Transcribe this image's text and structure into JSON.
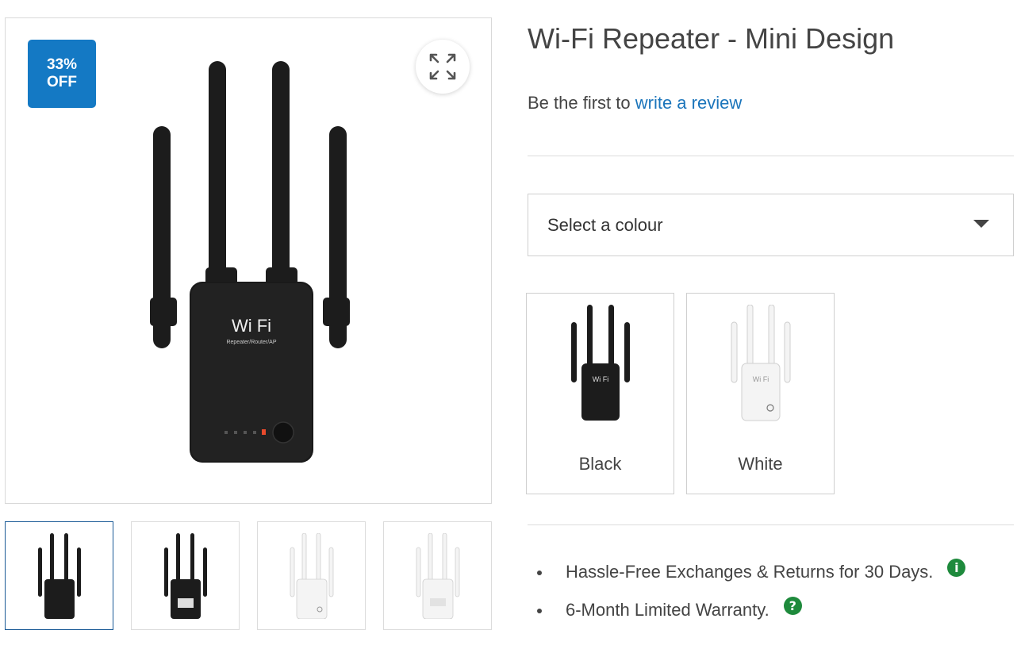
{
  "product": {
    "title": "Wi-Fi Repeater - Mini Design",
    "review_prefix": "Be the first to ",
    "review_link": "write a review"
  },
  "badge": {
    "line1": "33%",
    "line2": "OFF"
  },
  "device_text": {
    "brand": "Wi Fi",
    "model": "Repeater/Router/AP"
  },
  "colour_select": {
    "placeholder": "Select a colour"
  },
  "swatches": [
    {
      "label": "Black",
      "color": "#1c1c1c"
    },
    {
      "label": "White",
      "color": "#f2f2f2"
    }
  ],
  "thumbnails": [
    {
      "variant": "black",
      "active": true
    },
    {
      "variant": "black-back",
      "active": false
    },
    {
      "variant": "white",
      "active": false
    },
    {
      "variant": "white-back",
      "active": false
    }
  ],
  "features": [
    {
      "text": "Hassle-Free Exchanges & Returns for 30 Days.",
      "icon": "info-icon",
      "glyph": "i"
    },
    {
      "text": "6-Month Limited Warranty.",
      "icon": "help-icon",
      "glyph": "?"
    }
  ],
  "colors": {
    "accent": "#1b75bb",
    "badge": "#1479c4",
    "icon_green": "#1e8a3c"
  }
}
